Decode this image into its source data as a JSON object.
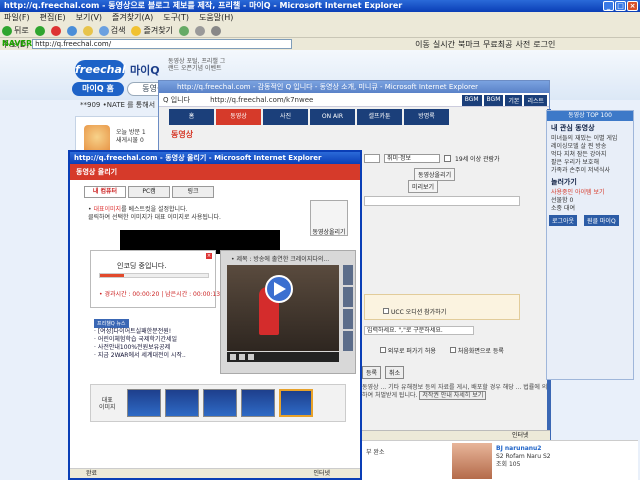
{
  "ie": {
    "title": "http://q.freechal.com - 동영상으로 블로그 제보를 제작, 프리챌 - 마이Q - Microsoft Internet Explorer",
    "menu": [
      "파일(F)",
      "편집(E)",
      "보기(V)",
      "즐겨찾기(A)",
      "도구(T)",
      "도움말(H)"
    ],
    "back": "뒤로",
    "search": "검색",
    "favorites": "즐겨찾기",
    "address_label": "주소(D)",
    "address": "http://q.freechal.com/",
    "go": "이동",
    "naver": "NAVER",
    "links": [
      "실시간",
      "북마크",
      "무료최공",
      "사전",
      "로그인"
    ]
  },
  "freechal": {
    "logo": "freechal",
    "maiq": "마이Q",
    "tagline": "동영상 포털, 프리챌 그랜드 오픈기념 이벤트",
    "tab_myq": "마이Q 홈",
    "tab_bang": "동영상방",
    "ticker": "**909 •NATE 를 통해서",
    "left_meta": [
      "오늘 방문 1",
      "새게시물 0"
    ]
  },
  "mini": {
    "title": "http://q.freechal.com - 감동적인 Q 입니다 - 동영상 소개, 미니큐 - Microsoft Internet Explorer",
    "owner": "Q 입니다",
    "url": "http://q.freechal.com/k7nwee",
    "bgm": [
      "BGM",
      "BGM",
      "기본",
      "리스트"
    ],
    "nav": [
      "홈",
      "동영상",
      "사진",
      "ON AIR",
      "셀프카툰",
      "방명록"
    ],
    "section": "동영상",
    "category": "취미·정보",
    "adult_label": "19세 이상 관람가",
    "upload_btn": "동영상올리기",
    "preview": "미리보기",
    "ucc_label": "UCC 오디션 참가하기",
    "tag_hint": "입력하세요. \",\"로 구분하세요.",
    "share_label": "외부로 퍼가기 허용",
    "register_label": "처음화면으로 등록",
    "btn_ok": "등록",
    "btn_cancel": "취소",
    "notice": "동영상 ... 기타 유해정보 등의 자료를 게시, 배포할 경우 해당 ... 법률에 의하여 처벌받게 됩니다.",
    "notice_btn": "저작권 안내 자세히 보기",
    "status": "인터넷"
  },
  "sidebar": {
    "top": "동영상 TOP 100",
    "sec1": "내 관심 동영상",
    "list1": [
      "미녀들의 재밌는 이별 게임",
      "레이싱모델 살 찐 방송",
      "먹다 지쳐 잠든 강아지",
      "팔은 우리가 보호해",
      "가족과 손주이 저녁식사"
    ],
    "sec2": "놀러가기",
    "recent": "사용중인 아이템 보기",
    "gift": "선물함 0",
    "mystore": "소중 대여",
    "btn_logout": "로그아웃",
    "btn_myq": "원클 마이Q"
  },
  "popup": {
    "title": "http://q.freechal.com - 동영상 올리기 - Microsoft Internet Explorer",
    "header": "동영상 올리기",
    "tabs": [
      "내 컴퓨터",
      "PC캠",
      "링크"
    ],
    "hint_red": "대표이미지",
    "hint_rest": "를 베스트컷을 설정합니다.",
    "hint2": "클릭하여 선택한 이미지가 대표 이미지로 사용됩니다.",
    "upload_btn": "동영상올리기",
    "progress_title": "인코딩 중입니다.",
    "progress_time": "• 경과시간 : 00:00:20 | 남은시간 : 00:00:13",
    "progress_fraction": 0.22,
    "video_caption": "• 제목 : 방송에 출연한 크레이지다의...",
    "news_header": "프리챌Q 뉴스",
    "news": [
      "[여성]다이어트실패한분전원!",
      "어린이체험학습 국제학기간세일",
      "사전안내100%전원보유공제",
      "지금 2WAR에서 세계대전이 시작.."
    ],
    "rep_label": "대표\n이미지",
    "status_left": "완료",
    "status_right": "인터넷"
  },
  "lower": {
    "left": "부 완소",
    "user": "BJ narunanu2",
    "line2": "S2 Rofam Naru S2",
    "line3": "조회 105"
  }
}
